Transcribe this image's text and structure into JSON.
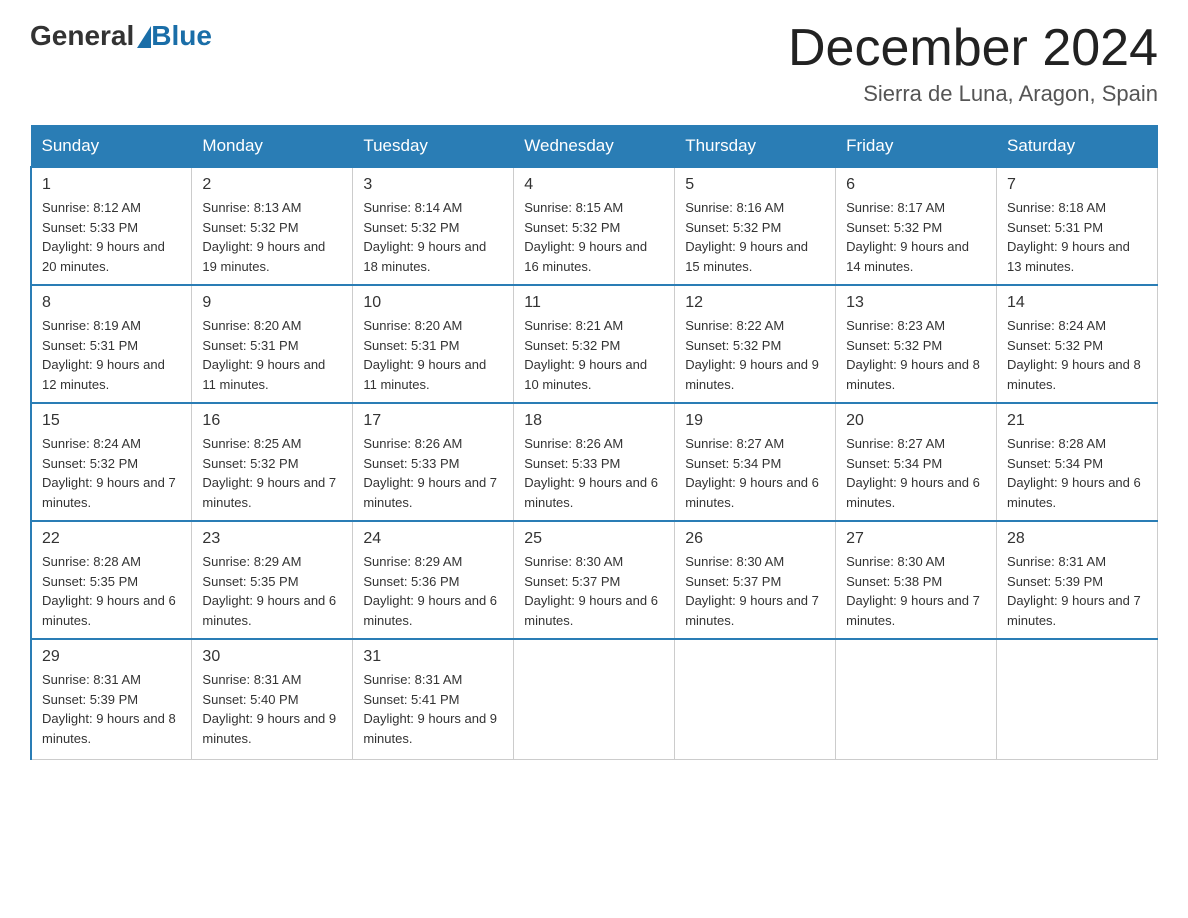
{
  "header": {
    "logo_general": "General",
    "logo_blue": "Blue",
    "month_title": "December 2024",
    "location": "Sierra de Luna, Aragon, Spain"
  },
  "days_of_week": [
    "Sunday",
    "Monday",
    "Tuesday",
    "Wednesday",
    "Thursday",
    "Friday",
    "Saturday"
  ],
  "weeks": [
    [
      {
        "day": "1",
        "sunrise": "8:12 AM",
        "sunset": "5:33 PM",
        "daylight": "9 hours and 20 minutes."
      },
      {
        "day": "2",
        "sunrise": "8:13 AM",
        "sunset": "5:32 PM",
        "daylight": "9 hours and 19 minutes."
      },
      {
        "day": "3",
        "sunrise": "8:14 AM",
        "sunset": "5:32 PM",
        "daylight": "9 hours and 18 minutes."
      },
      {
        "day": "4",
        "sunrise": "8:15 AM",
        "sunset": "5:32 PM",
        "daylight": "9 hours and 16 minutes."
      },
      {
        "day": "5",
        "sunrise": "8:16 AM",
        "sunset": "5:32 PM",
        "daylight": "9 hours and 15 minutes."
      },
      {
        "day": "6",
        "sunrise": "8:17 AM",
        "sunset": "5:32 PM",
        "daylight": "9 hours and 14 minutes."
      },
      {
        "day": "7",
        "sunrise": "8:18 AM",
        "sunset": "5:31 PM",
        "daylight": "9 hours and 13 minutes."
      }
    ],
    [
      {
        "day": "8",
        "sunrise": "8:19 AM",
        "sunset": "5:31 PM",
        "daylight": "9 hours and 12 minutes."
      },
      {
        "day": "9",
        "sunrise": "8:20 AM",
        "sunset": "5:31 PM",
        "daylight": "9 hours and 11 minutes."
      },
      {
        "day": "10",
        "sunrise": "8:20 AM",
        "sunset": "5:31 PM",
        "daylight": "9 hours and 11 minutes."
      },
      {
        "day": "11",
        "sunrise": "8:21 AM",
        "sunset": "5:32 PM",
        "daylight": "9 hours and 10 minutes."
      },
      {
        "day": "12",
        "sunrise": "8:22 AM",
        "sunset": "5:32 PM",
        "daylight": "9 hours and 9 minutes."
      },
      {
        "day": "13",
        "sunrise": "8:23 AM",
        "sunset": "5:32 PM",
        "daylight": "9 hours and 8 minutes."
      },
      {
        "day": "14",
        "sunrise": "8:24 AM",
        "sunset": "5:32 PM",
        "daylight": "9 hours and 8 minutes."
      }
    ],
    [
      {
        "day": "15",
        "sunrise": "8:24 AM",
        "sunset": "5:32 PM",
        "daylight": "9 hours and 7 minutes."
      },
      {
        "day": "16",
        "sunrise": "8:25 AM",
        "sunset": "5:32 PM",
        "daylight": "9 hours and 7 minutes."
      },
      {
        "day": "17",
        "sunrise": "8:26 AM",
        "sunset": "5:33 PM",
        "daylight": "9 hours and 7 minutes."
      },
      {
        "day": "18",
        "sunrise": "8:26 AM",
        "sunset": "5:33 PM",
        "daylight": "9 hours and 6 minutes."
      },
      {
        "day": "19",
        "sunrise": "8:27 AM",
        "sunset": "5:34 PM",
        "daylight": "9 hours and 6 minutes."
      },
      {
        "day": "20",
        "sunrise": "8:27 AM",
        "sunset": "5:34 PM",
        "daylight": "9 hours and 6 minutes."
      },
      {
        "day": "21",
        "sunrise": "8:28 AM",
        "sunset": "5:34 PM",
        "daylight": "9 hours and 6 minutes."
      }
    ],
    [
      {
        "day": "22",
        "sunrise": "8:28 AM",
        "sunset": "5:35 PM",
        "daylight": "9 hours and 6 minutes."
      },
      {
        "day": "23",
        "sunrise": "8:29 AM",
        "sunset": "5:35 PM",
        "daylight": "9 hours and 6 minutes."
      },
      {
        "day": "24",
        "sunrise": "8:29 AM",
        "sunset": "5:36 PM",
        "daylight": "9 hours and 6 minutes."
      },
      {
        "day": "25",
        "sunrise": "8:30 AM",
        "sunset": "5:37 PM",
        "daylight": "9 hours and 6 minutes."
      },
      {
        "day": "26",
        "sunrise": "8:30 AM",
        "sunset": "5:37 PM",
        "daylight": "9 hours and 7 minutes."
      },
      {
        "day": "27",
        "sunrise": "8:30 AM",
        "sunset": "5:38 PM",
        "daylight": "9 hours and 7 minutes."
      },
      {
        "day": "28",
        "sunrise": "8:31 AM",
        "sunset": "5:39 PM",
        "daylight": "9 hours and 7 minutes."
      }
    ],
    [
      {
        "day": "29",
        "sunrise": "8:31 AM",
        "sunset": "5:39 PM",
        "daylight": "9 hours and 8 minutes."
      },
      {
        "day": "30",
        "sunrise": "8:31 AM",
        "sunset": "5:40 PM",
        "daylight": "9 hours and 9 minutes."
      },
      {
        "day": "31",
        "sunrise": "8:31 AM",
        "sunset": "5:41 PM",
        "daylight": "9 hours and 9 minutes."
      },
      null,
      null,
      null,
      null
    ]
  ]
}
